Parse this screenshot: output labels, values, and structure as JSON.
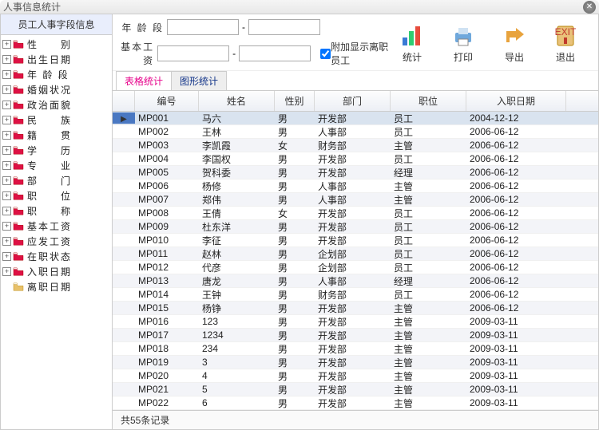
{
  "window": {
    "title": "人事信息统计"
  },
  "sidebar": {
    "header": "员工人事字段信息",
    "items": [
      {
        "label": "性　　别",
        "red": true,
        "expandable": true
      },
      {
        "label": "出生日期",
        "red": true,
        "expandable": true
      },
      {
        "label": "年 龄 段",
        "red": true,
        "expandable": true
      },
      {
        "label": "婚姻状况",
        "red": true,
        "expandable": true
      },
      {
        "label": "政治面貌",
        "red": true,
        "expandable": true
      },
      {
        "label": "民　　族",
        "red": true,
        "expandable": true
      },
      {
        "label": "籍　　贯",
        "red": true,
        "expandable": true
      },
      {
        "label": "学　　历",
        "red": true,
        "expandable": true
      },
      {
        "label": "专　　业",
        "red": true,
        "expandable": true
      },
      {
        "label": "部　　门",
        "red": true,
        "expandable": true
      },
      {
        "label": "职　　位",
        "red": true,
        "expandable": true
      },
      {
        "label": "职　　称",
        "red": true,
        "expandable": true
      },
      {
        "label": "基本工资",
        "red": true,
        "expandable": true
      },
      {
        "label": "应发工资",
        "red": true,
        "expandable": true
      },
      {
        "label": "在职状态",
        "red": true,
        "expandable": true
      },
      {
        "label": "入职日期",
        "red": true,
        "expandable": true
      },
      {
        "label": "离职日期",
        "red": false,
        "expandable": false
      }
    ]
  },
  "filters": {
    "age_label": "年 龄 段",
    "salary_label": "基本工资",
    "sep": "-",
    "age_from": "",
    "age_to": "",
    "salary_from": "",
    "salary_to": "",
    "checkbox_label": "附加显示离职员工",
    "checkbox_checked": true
  },
  "toolbar": {
    "stat": "统计",
    "print": "打印",
    "export": "导出",
    "exit": "退出"
  },
  "tabs": {
    "table": "表格统计",
    "chart": "图形统计"
  },
  "table": {
    "headers": [
      "",
      "编号",
      "姓名",
      "性别",
      "部门",
      "职位",
      "入职日期"
    ],
    "rows": [
      {
        "sel": true,
        "c": [
          "MP001",
          "马六",
          "男",
          "开发部",
          "员工",
          "2004-12-12"
        ]
      },
      {
        "c": [
          "MP002",
          "王林",
          "男",
          "人事部",
          "员工",
          "2006-06-12"
        ]
      },
      {
        "c": [
          "MP003",
          "李凯霞",
          "女",
          "财务部",
          "主管",
          "2006-06-12"
        ]
      },
      {
        "c": [
          "MP004",
          "李国权",
          "男",
          "开发部",
          "员工",
          "2006-06-12"
        ]
      },
      {
        "c": [
          "MP005",
          "贺科委",
          "男",
          "开发部",
          "经理",
          "2006-06-12"
        ]
      },
      {
        "c": [
          "MP006",
          "杨修",
          "男",
          "人事部",
          "主管",
          "2006-06-12"
        ]
      },
      {
        "c": [
          "MP007",
          "郑伟",
          "男",
          "人事部",
          "主管",
          "2006-06-12"
        ]
      },
      {
        "c": [
          "MP008",
          "王倩",
          "女",
          "开发部",
          "员工",
          "2006-06-12"
        ]
      },
      {
        "c": [
          "MP009",
          "杜东洋",
          "男",
          "开发部",
          "员工",
          "2006-06-12"
        ]
      },
      {
        "c": [
          "MP010",
          "李征",
          "男",
          "开发部",
          "员工",
          "2006-06-12"
        ]
      },
      {
        "c": [
          "MP011",
          "赵林",
          "男",
          "企划部",
          "员工",
          "2006-06-12"
        ]
      },
      {
        "c": [
          "MP012",
          "代彦",
          "男",
          "企划部",
          "员工",
          "2006-06-12"
        ]
      },
      {
        "c": [
          "MP013",
          "唐龙",
          "男",
          "人事部",
          "经理",
          "2006-06-12"
        ]
      },
      {
        "c": [
          "MP014",
          "王钟",
          "男",
          "财务部",
          "员工",
          "2006-06-12"
        ]
      },
      {
        "c": [
          "MP015",
          "杨铮",
          "男",
          "开发部",
          "主管",
          "2006-06-12"
        ]
      },
      {
        "c": [
          "MP016",
          "123",
          "男",
          "开发部",
          "主管",
          "2009-03-11"
        ]
      },
      {
        "c": [
          "MP017",
          "1234",
          "男",
          "开发部",
          "主管",
          "2009-03-11"
        ]
      },
      {
        "c": [
          "MP018",
          "234",
          "男",
          "开发部",
          "主管",
          "2009-03-11"
        ]
      },
      {
        "c": [
          "MP019",
          "3",
          "男",
          "开发部",
          "主管",
          "2009-03-11"
        ]
      },
      {
        "c": [
          "MP020",
          "4",
          "男",
          "开发部",
          "主管",
          "2009-03-11"
        ]
      },
      {
        "c": [
          "MP021",
          "5",
          "男",
          "开发部",
          "主管",
          "2009-03-11"
        ]
      },
      {
        "c": [
          "MP022",
          "6",
          "男",
          "开发部",
          "主管",
          "2009-03-11"
        ]
      }
    ],
    "footer": "共55条记录"
  }
}
